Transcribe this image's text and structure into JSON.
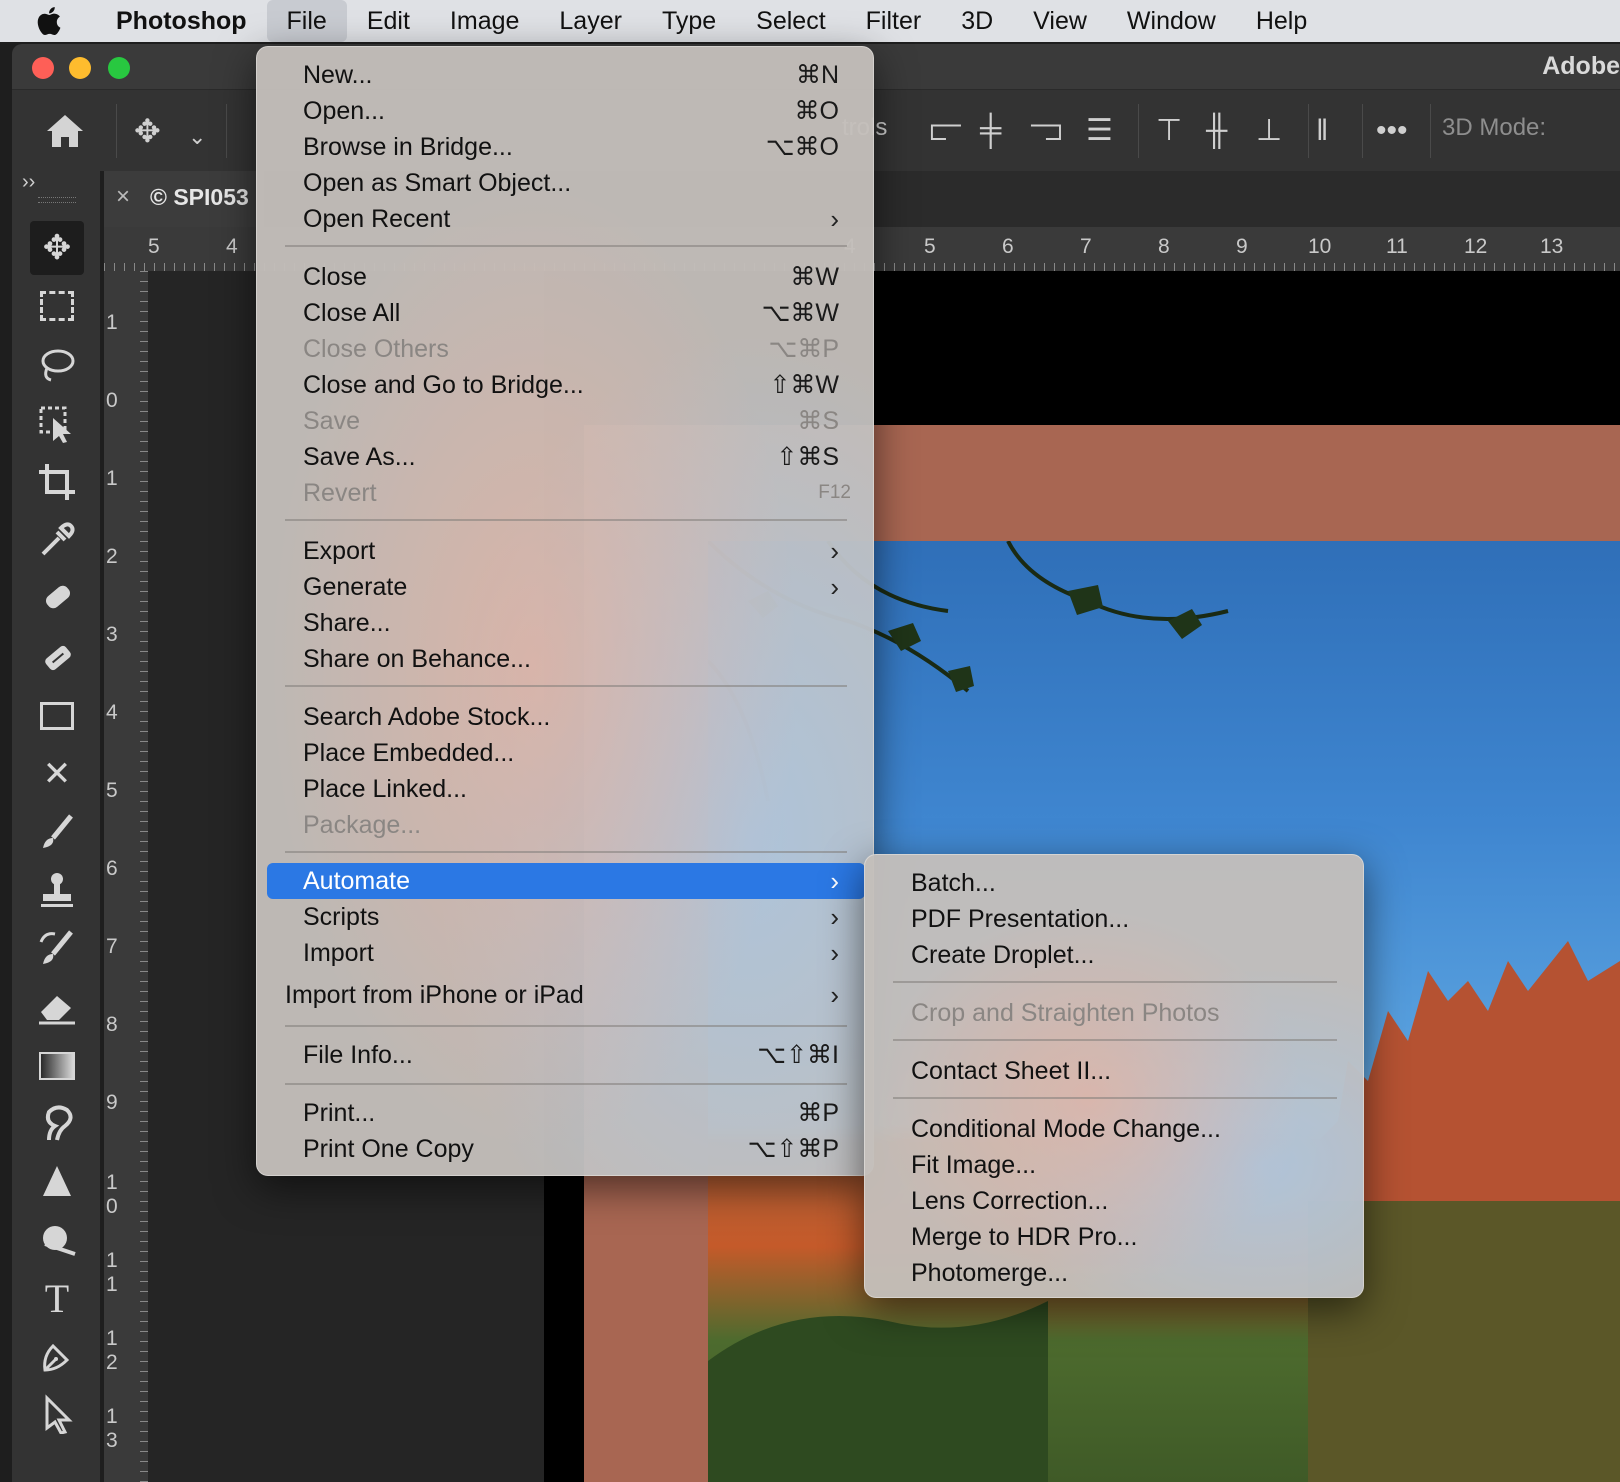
{
  "menubar": {
    "app_name": "Photoshop",
    "items": [
      "File",
      "Edit",
      "Image",
      "Layer",
      "Type",
      "Select",
      "Filter",
      "3D",
      "View",
      "Window",
      "Help"
    ]
  },
  "window": {
    "title": "Adobe",
    "colors": {
      "close": "#fe5f57",
      "minimize": "#febc2e",
      "zoom": "#28c840"
    }
  },
  "options_bar": {
    "partial_label": "trols",
    "mode_label": "3D Mode:"
  },
  "document": {
    "tab_title": "© SPI053",
    "tab_close": "×",
    "panel_toggle": "››"
  },
  "rulers": {
    "horizontal": [
      "5",
      "4",
      "4",
      "5",
      "6",
      "7",
      "8",
      "9",
      "10",
      "11",
      "12",
      "13"
    ],
    "vertical": [
      "1",
      "0",
      "1",
      "2",
      "3",
      "4",
      "5",
      "6",
      "7",
      "8",
      "9",
      "1 0",
      "1 1",
      "1 2",
      "1 3"
    ]
  },
  "tools": [
    "move-tool",
    "marquee-tool",
    "lasso-tool",
    "object-select-tool",
    "crop-tool",
    "eyedropper-tool",
    "spot-healing-tool",
    "healing-brush-tool",
    "content-aware-tool",
    "red-eye-tool",
    "brush-tool",
    "stamp-tool",
    "history-brush-tool",
    "eraser-tool",
    "gradient-tool",
    "blur-tool",
    "sharpen-tool",
    "dodge-tool",
    "type-tool",
    "pen-tool",
    "path-select-tool"
  ],
  "file_menu": {
    "items": [
      {
        "label": "New...",
        "shortcut": "⌘N"
      },
      {
        "label": "Open...",
        "shortcut": "⌘O"
      },
      {
        "label": "Browse in Bridge...",
        "shortcut": "⌥⌘O"
      },
      {
        "label": "Open as Smart Object...",
        "shortcut": ""
      },
      {
        "label": "Open Recent",
        "submenu": true
      },
      {
        "label": "Close",
        "shortcut": "⌘W"
      },
      {
        "label": "Close All",
        "shortcut": "⌥⌘W"
      },
      {
        "label": "Close Others",
        "shortcut": "⌥⌘P",
        "disabled": true
      },
      {
        "label": "Close and Go to Bridge...",
        "shortcut": "⇧⌘W"
      },
      {
        "label": "Save",
        "shortcut": "⌘S",
        "disabled": true
      },
      {
        "label": "Save As...",
        "shortcut": "⇧⌘S"
      },
      {
        "label": "Revert",
        "shortcut": "F12",
        "disabled": true
      },
      {
        "label": "Export",
        "submenu": true
      },
      {
        "label": "Generate",
        "submenu": true
      },
      {
        "label": "Share...",
        "shortcut": ""
      },
      {
        "label": "Share on Behance...",
        "shortcut": ""
      },
      {
        "label": "Search Adobe Stock...",
        "shortcut": ""
      },
      {
        "label": "Place Embedded...",
        "shortcut": ""
      },
      {
        "label": "Place Linked...",
        "shortcut": ""
      },
      {
        "label": "Package...",
        "shortcut": "",
        "disabled": true
      },
      {
        "label": "Automate",
        "submenu": true,
        "highlighted": true
      },
      {
        "label": "Scripts",
        "submenu": true
      },
      {
        "label": "Import",
        "submenu": true
      },
      {
        "label": "Import from iPhone or iPad",
        "submenu": true
      },
      {
        "label": "File Info...",
        "shortcut": "⌥⇧⌘I"
      },
      {
        "label": "Print...",
        "shortcut": "⌘P"
      },
      {
        "label": "Print One Copy",
        "shortcut": "⌥⇧⌘P"
      }
    ],
    "highlight_color": "#2b78e4",
    "chevron": "›"
  },
  "automate_submenu": {
    "items": [
      {
        "label": "Batch..."
      },
      {
        "label": "PDF Presentation..."
      },
      {
        "label": "Create Droplet..."
      },
      {
        "label": "Crop and Straighten Photos",
        "disabled": true
      },
      {
        "label": "Contact Sheet II..."
      },
      {
        "label": "Conditional Mode Change..."
      },
      {
        "label": "Fit Image..."
      },
      {
        "label": "Lens Correction..."
      },
      {
        "label": "Merge to HDR Pro..."
      },
      {
        "label": "Photomerge..."
      }
    ]
  }
}
